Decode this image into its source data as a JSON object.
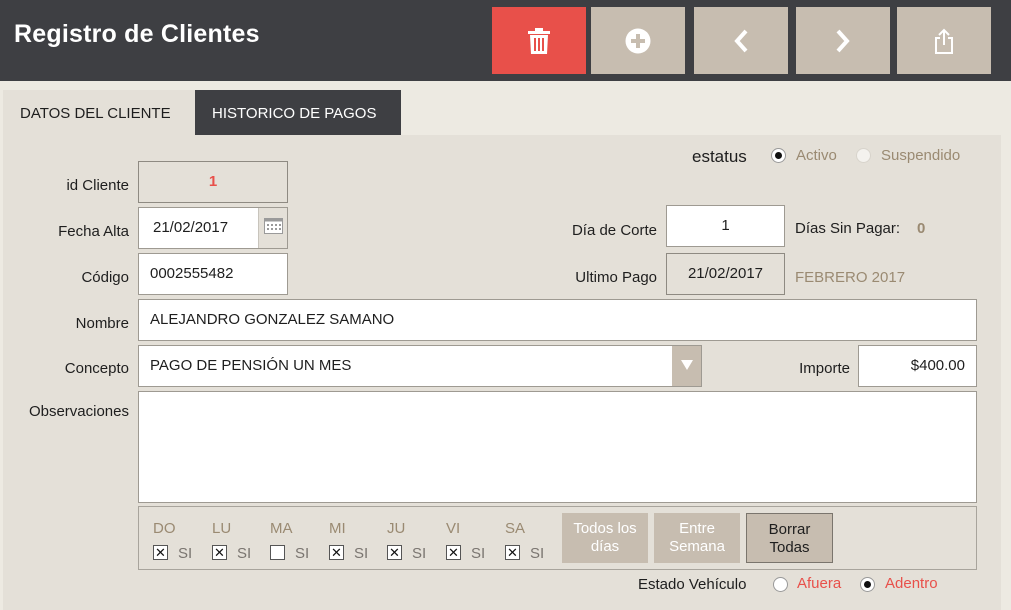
{
  "header": {
    "title": "Registro de Clientes",
    "colors": {
      "bar": "#3e3f43",
      "delete": "#e8504a",
      "button": "#c7bdb0"
    },
    "buttons": [
      {
        "name": "delete-button",
        "icon": "trash-icon"
      },
      {
        "name": "add-button",
        "icon": "plus-circle-icon"
      },
      {
        "name": "previous-button",
        "icon": "chevron-left-icon"
      },
      {
        "name": "next-button",
        "icon": "chevron-right-icon"
      },
      {
        "name": "export-button",
        "icon": "share-icon"
      }
    ]
  },
  "tabs": [
    {
      "label": "DATOS DEL CLIENTE",
      "active": true
    },
    {
      "label": "HISTORICO DE PAGOS",
      "active": false
    }
  ],
  "status": {
    "label": "estatus",
    "options": [
      {
        "label": "Activo",
        "selected": true
      },
      {
        "label": "Suspendido",
        "selected": false
      }
    ]
  },
  "form": {
    "id_label": "id Cliente",
    "id_value": "1",
    "fecha_alta_label": "Fecha Alta",
    "fecha_alta_value": "21/02/2017",
    "codigo_label": "Código",
    "codigo_value": "0002555482",
    "nombre_label": "Nombre",
    "nombre_value": "ALEJANDRO GONZALEZ SAMANO",
    "concepto_label": "Concepto",
    "concepto_value": "PAGO DE PENSIÓN UN MES",
    "observaciones_label": "Observaciones",
    "observaciones_value": "",
    "dia_corte_label": "Día de Corte",
    "dia_corte_value": "1",
    "dias_sin_pagar_label": "Días Sin Pagar:",
    "dias_sin_pagar_value": "0",
    "ultimo_pago_label": "Ultimo Pago",
    "ultimo_pago_value": "21/02/2017",
    "ultimo_pago_mes": "FEBRERO 2017",
    "importe_label": "Importe",
    "importe_value": "$400.00"
  },
  "days": {
    "items": [
      {
        "name": "DO",
        "checked": true,
        "si": "SI"
      },
      {
        "name": "LU",
        "checked": true,
        "si": "SI"
      },
      {
        "name": "MA",
        "checked": false,
        "si": "SI"
      },
      {
        "name": "MI",
        "checked": true,
        "si": "SI"
      },
      {
        "name": "JU",
        "checked": true,
        "si": "SI"
      },
      {
        "name": "VI",
        "checked": true,
        "si": "SI"
      },
      {
        "name": "SA",
        "checked": true,
        "si": "SI"
      }
    ],
    "todos_label_1": "Todos los",
    "todos_label_2": "días",
    "semana_label_1": "Entre",
    "semana_label_2": "Semana",
    "borrar_label_1": "Borrar",
    "borrar_label_2": "Todas"
  },
  "vehiculo": {
    "label": "Estado Vehículo",
    "options": [
      {
        "label": "Afuera",
        "selected": false
      },
      {
        "label": "Adentro",
        "selected": true
      }
    ],
    "option_color": "#e8504a"
  }
}
